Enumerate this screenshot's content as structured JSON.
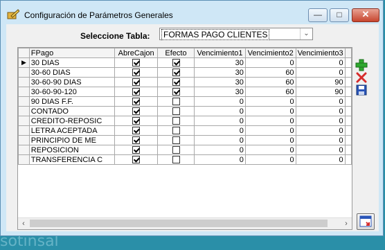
{
  "window": {
    "title": "Configuración de Parámetros Generales"
  },
  "form": {
    "select_label": "Seleccione Tabla:",
    "selected_table": "FORMAS PAGO CLIENTES"
  },
  "grid": {
    "columns": [
      "FPago",
      "AbreCajon",
      "Efecto",
      "Vencimiento1",
      "Vencimiento2",
      "Vencimiento3"
    ],
    "rows": [
      {
        "fpago": "30 DIAS",
        "abre": true,
        "efecto": true,
        "v1": "30",
        "v2": "0",
        "v3": "0"
      },
      {
        "fpago": "30-60 DIAS",
        "abre": true,
        "efecto": true,
        "v1": "30",
        "v2": "60",
        "v3": "0"
      },
      {
        "fpago": "30-60-90 DIAS",
        "abre": true,
        "efecto": true,
        "v1": "30",
        "v2": "60",
        "v3": "90"
      },
      {
        "fpago": "30-60-90-120",
        "abre": true,
        "efecto": true,
        "v1": "30",
        "v2": "60",
        "v3": "90"
      },
      {
        "fpago": "90 DIAS F.F.",
        "abre": true,
        "efecto": false,
        "v1": "0",
        "v2": "0",
        "v3": "0"
      },
      {
        "fpago": "CONTADO",
        "abre": true,
        "efecto": false,
        "v1": "0",
        "v2": "0",
        "v3": "0"
      },
      {
        "fpago": "CREDITO-REPOSIC",
        "abre": true,
        "efecto": false,
        "v1": "0",
        "v2": "0",
        "v3": "0"
      },
      {
        "fpago": "LETRA ACEPTADA",
        "abre": true,
        "efecto": false,
        "v1": "0",
        "v2": "0",
        "v3": "0"
      },
      {
        "fpago": "PRINCIPIO DE ME",
        "abre": true,
        "efecto": false,
        "v1": "0",
        "v2": "0",
        "v3": "0"
      },
      {
        "fpago": "REPOSICION",
        "abre": true,
        "efecto": false,
        "v1": "0",
        "v2": "0",
        "v3": "0"
      },
      {
        "fpago": "TRANSFERENCIA C",
        "abre": true,
        "efecto": false,
        "v1": "0",
        "v2": "0",
        "v3": "0"
      }
    ]
  },
  "icons": {
    "add": "plus-icon",
    "delete": "x-icon",
    "save": "floppy-icon",
    "exit": "exit-window-icon",
    "add_color": "#2ea82e",
    "delete_color": "#d62b2b",
    "save_color": "#2a55b8"
  },
  "background_text": "sotinsal"
}
